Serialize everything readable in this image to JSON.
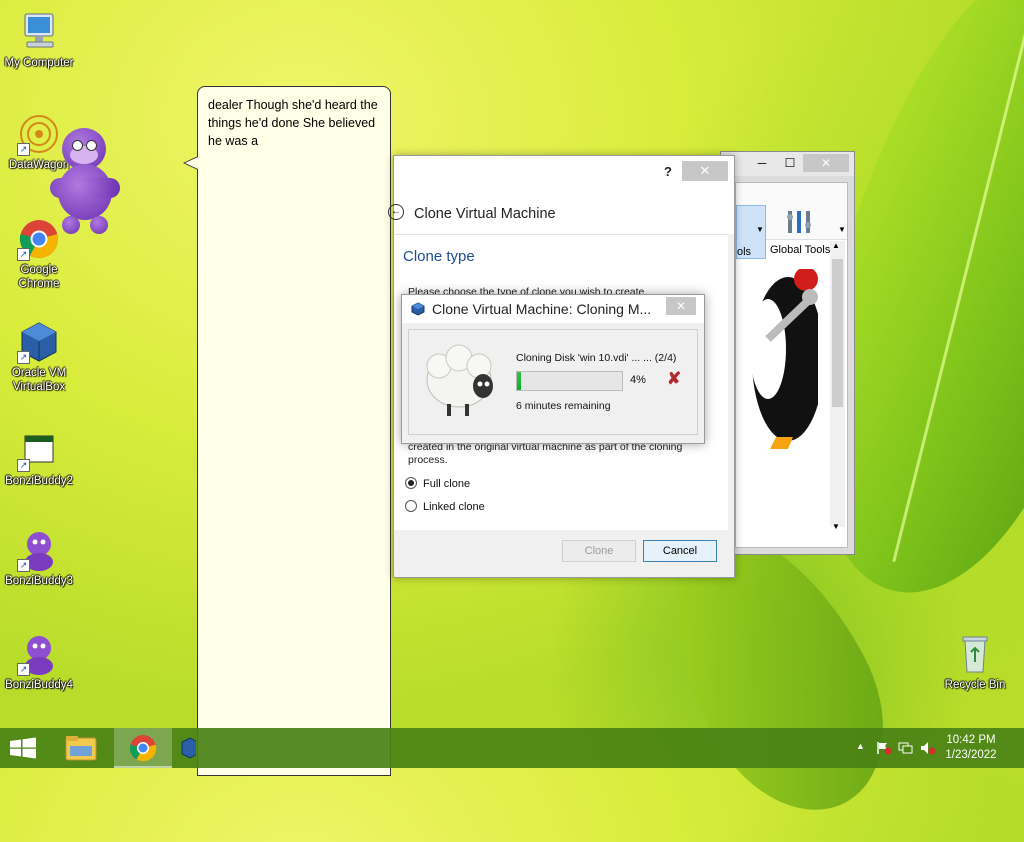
{
  "desktop": {
    "icons": [
      {
        "label": "My Computer"
      },
      {
        "label": "DataWagon"
      },
      {
        "label": "Google Chrome"
      },
      {
        "label": "Oracle VM VirtualBox"
      },
      {
        "label": "BonziBuddy2"
      },
      {
        "label": "BonziBuddy3"
      },
      {
        "label": "BonziBuddy4"
      },
      {
        "label": "Recycle Bin"
      }
    ]
  },
  "balloon": {
    "text": "dealer Though she'd heard the things he'd done She believed he was a"
  },
  "manager": {
    "tools_partial": "ols",
    "global_tools": "Global Tools"
  },
  "wizard": {
    "help": "?",
    "close": "✕",
    "title": "Clone Virtual Machine",
    "section": "Clone type",
    "desc_top": "Please choose the type of clone you wish to create.",
    "desc_bottom": "created in the original virtual machine as part of the cloning process.",
    "options": [
      {
        "label": "Full clone",
        "selected": true
      },
      {
        "label": "Linked clone",
        "selected": false
      }
    ],
    "clone_button": "Clone",
    "cancel_button": "Cancel"
  },
  "progress": {
    "title": "Clone Virtual Machine: Cloning M...",
    "close": "✕",
    "status": "Cloning Disk 'win 10.vdi' ... ... (2/4)",
    "percent_value": 4,
    "percent_label": "4%",
    "remaining": "6 minutes remaining"
  },
  "taskbar": {
    "time": "10:42 PM",
    "date": "1/23/2022"
  },
  "colors": {
    "accent_blue": "#1c4f91",
    "progress_green": "#06b025",
    "taskbar": "#4a8216"
  }
}
